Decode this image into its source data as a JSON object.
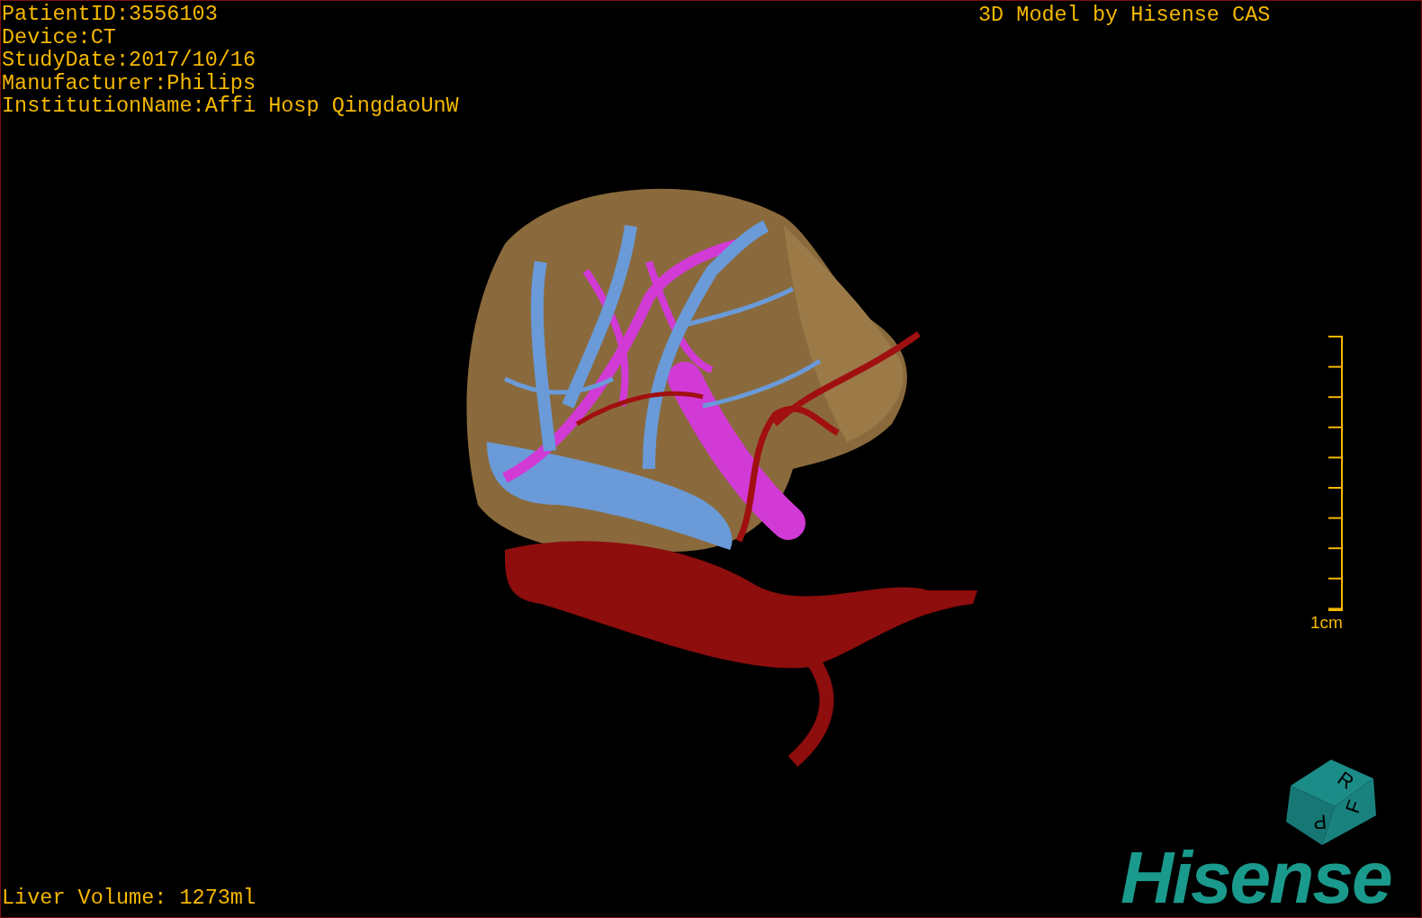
{
  "info_lines": [
    "PatientID:3556103",
    "Device:CT",
    "StudyDate:2017/10/16",
    "Manufacturer:Philips",
    "InstitutionName:Affi Hosp QingdaoUnW"
  ],
  "credit": "3D Model by Hisense CAS",
  "scale_bar": {
    "label": "1cm"
  },
  "orientation_cube": {
    "faces": [
      "R",
      "F",
      "P"
    ]
  },
  "logo": "Hisense",
  "liver_volume": "Liver Volume: 1273ml"
}
